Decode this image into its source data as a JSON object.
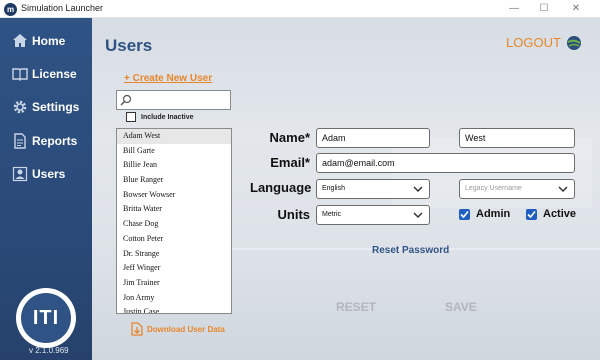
{
  "window": {
    "title": "Simulation Launcher",
    "app_icon_text": "m",
    "minimize": "—",
    "maximize": "☐",
    "close": "✕"
  },
  "sidebar": {
    "items": [
      {
        "label": "Home",
        "icon": "home-icon"
      },
      {
        "label": "License",
        "icon": "book-icon"
      },
      {
        "label": "Settings",
        "icon": "gear-icon"
      },
      {
        "label": "Reports",
        "icon": "document-icon"
      },
      {
        "label": "Users",
        "icon": "user-icon"
      }
    ],
    "logo_text": "ITI",
    "version": "v 2.1.0.969"
  },
  "main": {
    "title": "Users",
    "logout": "LOGOUT",
    "create_user": "+ Create New User",
    "search": {
      "value": "",
      "placeholder": ""
    },
    "include_inactive": {
      "label": "Include Inactive",
      "checked": false
    },
    "users": [
      "Adam West",
      "Bill Garte",
      "Billie Jean",
      "Blue Ranger",
      "Bowser Wowser",
      "Britta Water",
      "Chase Dog",
      "Cotton Peter",
      "Dr. Strange",
      "Jeff Winger",
      "Jim Trainer",
      "Jon Army",
      "Justin Case"
    ],
    "selected_user": "Adam West",
    "download": "Download User Data"
  },
  "form": {
    "name_label": "Name*",
    "first_name": "Adam",
    "last_name": "West",
    "email_label": "Email*",
    "email": "adam@email.com",
    "language_label": "Language",
    "language_value": "English",
    "legacy_username_placeholder": "Legacy Username",
    "units_label": "Units",
    "units_value": "Metric",
    "admin_label": "Admin",
    "admin_checked": true,
    "active_label": "Active",
    "active_checked": true,
    "reset_password": "Reset Password",
    "reset_button": "RESET",
    "save_button": "SAVE"
  },
  "colors": {
    "sidebar": "#2f5385",
    "accent_orange": "#e8862b",
    "title_blue": "#2f5385",
    "checkbox_blue": "#1f5fbf",
    "disabled_text": "#b3b7bc"
  }
}
